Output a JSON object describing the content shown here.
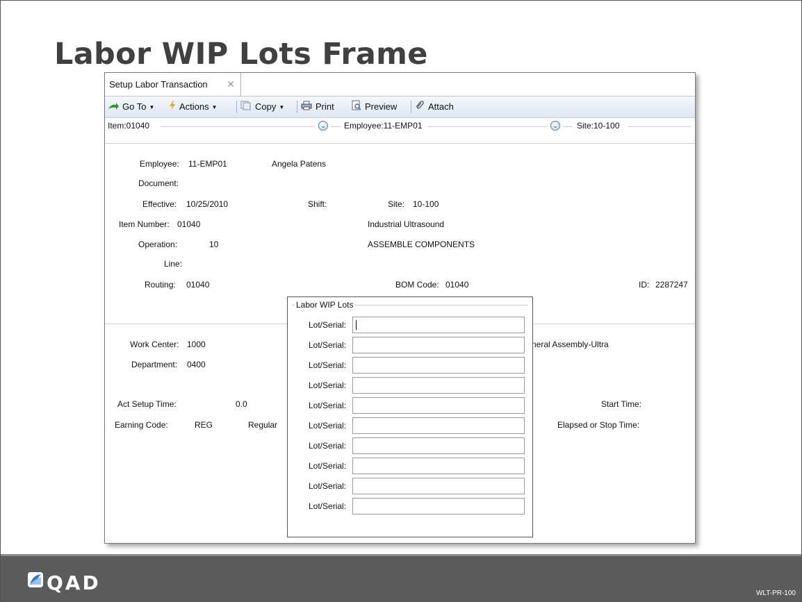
{
  "slide": {
    "title": "Labor WIP Lots Frame",
    "brand": "QAD",
    "code": "WLT-PR-100"
  },
  "tab": {
    "label": "Setup Labor Transaction",
    "close": "✕"
  },
  "toolbar": {
    "goto": "Go To",
    "actions": "Actions",
    "copy": "Copy",
    "print": "Print",
    "preview": "Preview",
    "attach": "Attach"
  },
  "filters": {
    "item": "Item:01040",
    "employee": "Employee:11-EMP01",
    "site": "Site:10-100"
  },
  "header": {
    "employee_label": "Employee:",
    "employee_value": "11-EMP01",
    "employee_name": "Angela Patens",
    "document_label": "Document:",
    "effective_label": "Effective:",
    "effective_value": "10/25/2010",
    "shift_label": "Shift:",
    "site_label": "Site:",
    "site_value": "10-100",
    "item_label": "Item Number:",
    "item_value": "01040",
    "item_desc": "Industrial Ultrasound",
    "operation_label": "Operation:",
    "operation_value": "10",
    "operation_desc": "ASSEMBLE COMPONENTS",
    "line_label": "Line:",
    "routing_label": "Routing:",
    "routing_value": "01040",
    "bom_label": "BOM Code:",
    "bom_value": "01040",
    "id_label": "ID:",
    "id_value": "2287247"
  },
  "detail": {
    "workcenter_label": "Work Center:",
    "workcenter_value": "1000",
    "workcenter_desc": "neral Assembly-Ultra",
    "department_label": "Department:",
    "department_value": "0400",
    "setup_label": "Act Setup Time:",
    "setup_value": "0.0",
    "earning_label": "Earning Code:",
    "earning_value": "REG",
    "earning_desc": "Regular",
    "start_label": "Start Time:",
    "elapsed_label": "Elapsed or Stop Time:"
  },
  "wip": {
    "title": "Labor WIP Lots",
    "rows": [
      "Lot/Serial:",
      "Lot/Serial:",
      "Lot/Serial:",
      "Lot/Serial:",
      "Lot/Serial:",
      "Lot/Serial:",
      "Lot/Serial:",
      "Lot/Serial:",
      "Lot/Serial:",
      "Lot/Serial:"
    ]
  }
}
